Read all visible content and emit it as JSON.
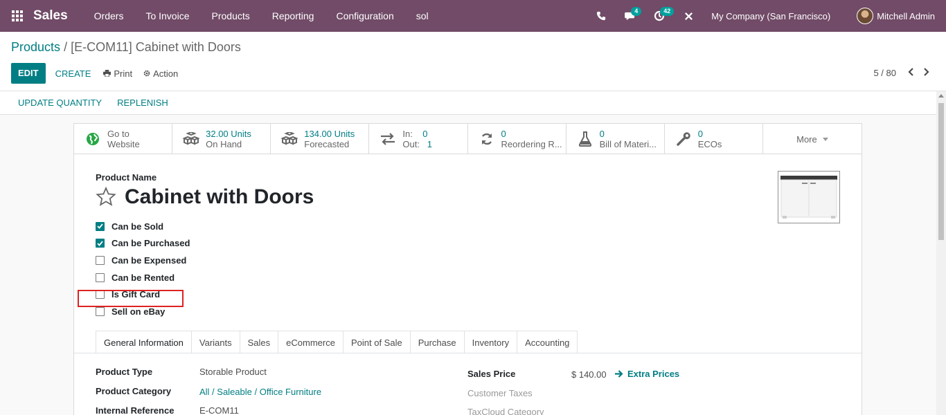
{
  "navbar": {
    "app_name": "Sales",
    "menu": [
      "Orders",
      "To Invoice",
      "Products",
      "Reporting",
      "Configuration",
      "sol"
    ],
    "messages_count": "4",
    "activities_count": "42",
    "company": "My Company (San Francisco)",
    "user": "Mitchell Admin"
  },
  "breadcrumb": {
    "parent": "Products",
    "separator": "/",
    "current": "[E-COM11] Cabinet with Doors"
  },
  "toolbar": {
    "edit": "EDIT",
    "create": "CREATE",
    "print": "Print",
    "action": "Action"
  },
  "pager": {
    "value": "5 / 80"
  },
  "statusbar": {
    "update_quantity": "UPDATE QUANTITY",
    "replenish": "REPLENISH"
  },
  "smart_buttons": [
    {
      "line1": "Go to",
      "line2": "Website",
      "icon": "globe-icon"
    },
    {
      "line1": "32.00 Units",
      "line2": "On Hand",
      "icon": "cubes-icon"
    },
    {
      "line1": "134.00 Units",
      "line2": "Forecasted",
      "icon": "cubes-icon"
    },
    {
      "line1": "In:",
      "line1_value": "0",
      "line2": "Out:",
      "line2_value": "1",
      "icon": "exchange-icon"
    },
    {
      "line1": "0",
      "line2": "Reordering R...",
      "icon": "refresh-icon"
    },
    {
      "line1": "0",
      "line2": "Bill of Materi...",
      "icon": "flask-icon"
    },
    {
      "line1": "0",
      "line2": "ECOs",
      "icon": "wrench-icon"
    }
  ],
  "more_label": "More",
  "form": {
    "product_name_label": "Product Name",
    "product_name": "Cabinet with Doors",
    "checkboxes": [
      {
        "label": "Can be Sold",
        "checked": true
      },
      {
        "label": "Can be Purchased",
        "checked": true
      },
      {
        "label": "Can be Expensed",
        "checked": false
      },
      {
        "label": "Can be Rented",
        "checked": false
      },
      {
        "label": "Is Gift Card",
        "checked": false
      },
      {
        "label": "Sell on eBay",
        "checked": false
      }
    ]
  },
  "tabs": [
    "General Information",
    "Variants",
    "Sales",
    "eCommerce",
    "Point of Sale",
    "Purchase",
    "Inventory",
    "Accounting"
  ],
  "fields": {
    "product_type_label": "Product Type",
    "product_type": "Storable Product",
    "product_category_label": "Product Category",
    "product_category": "All / Saleable / Office Furniture",
    "internal_reference_label": "Internal Reference",
    "internal_reference": "E-COM11",
    "sales_price_label": "Sales Price",
    "sales_price": "$ 140.00",
    "extra_prices": "Extra Prices",
    "customer_taxes_label": "Customer Taxes",
    "taxcloud_category_label": "TaxCloud Category"
  },
  "colors": {
    "navbar": "#714b67",
    "primary": "#017e84",
    "highlight": "#dd2222"
  }
}
